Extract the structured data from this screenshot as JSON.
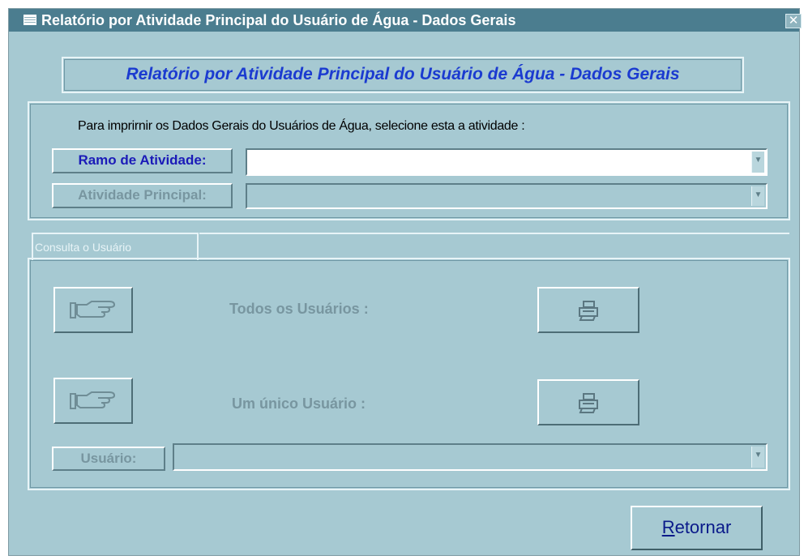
{
  "window": {
    "title": "Relatório por Atividade Principal do Usuário de Água - Dados Gerais",
    "close_glyph": "✕"
  },
  "header": {
    "banner": "Relatório por Atividade Principal do Usuário de Água - Dados Gerais"
  },
  "filter": {
    "instruction": "Para imprirnir os Dados Gerais do Usuários de Água, selecione esta a atividade :",
    "ramo_label": "Ramo de Atividade:",
    "ramo_value": "",
    "atividade_label": "Atividade Principal:",
    "atividade_value": ""
  },
  "query": {
    "tab_label": "Consulta o Usuário",
    "todos_label": "Todos os Usuários :",
    "unico_label": "Um único Usuário :",
    "usuario_label": "Usuário:",
    "usuario_value": ""
  },
  "footer": {
    "return_accel": "R",
    "return_rest": "etornar"
  },
  "icons": {
    "pointing_hand": "pointing-hand-icon",
    "printer": "printer-icon",
    "dropdown": "chevron-down-icon"
  },
  "colors": {
    "window_bg": "#a6c9d2",
    "title_bar": "#4b7d8f",
    "banner_text": "#1b3bd0",
    "disabled_text": "#7896a0"
  }
}
